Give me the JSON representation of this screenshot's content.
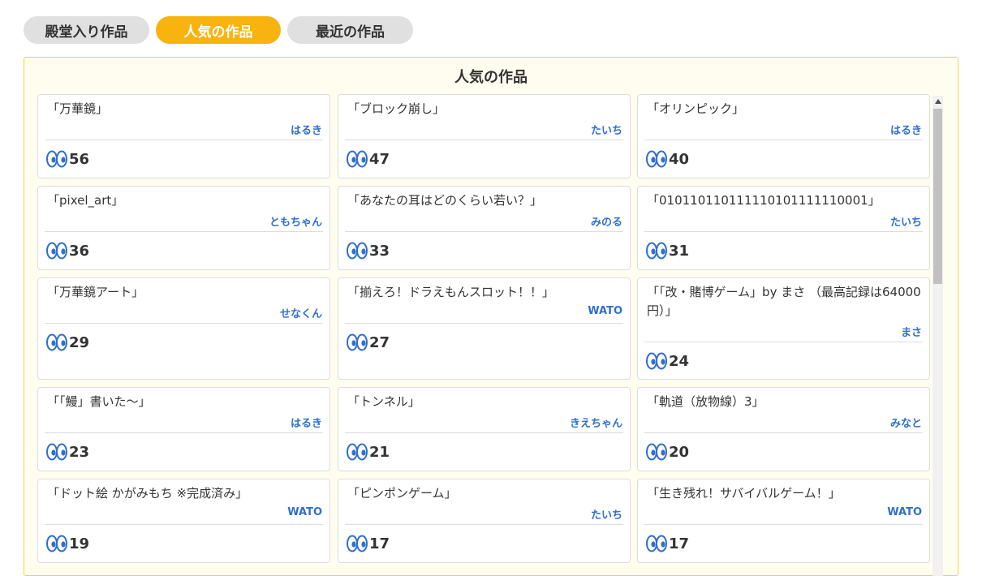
{
  "tabs": [
    {
      "label": "殿堂入り作品",
      "active": false
    },
    {
      "label": "人気の作品",
      "active": true
    },
    {
      "label": "最近の作品",
      "active": false
    }
  ],
  "panel": {
    "title": "人気の作品"
  },
  "icons": {
    "views": "eyes-icon",
    "scroll_up": "arrow-up-icon"
  },
  "colors": {
    "accent": "#f8b30f",
    "author": "#2f6fcf",
    "eyes": "#2f6fcf",
    "panel_border": "#f0d23c",
    "panel_bg": "#fffdf0"
  },
  "works": [
    {
      "title": "「万華鏡」",
      "author": "はるき",
      "views": "56"
    },
    {
      "title": "「ブロック崩し」",
      "author": "たいち",
      "views": "47"
    },
    {
      "title": "「オリンピック」",
      "author": "はるき",
      "views": "40"
    },
    {
      "title": "「pixel_art」",
      "author": "ともちゃん",
      "views": "36"
    },
    {
      "title": "「あなたの耳はどのくらい若い？」",
      "author": "みのる",
      "views": "33"
    },
    {
      "title": "「010110110111110101111110001」",
      "author": "たいち",
      "views": "31"
    },
    {
      "title": "「万華鏡アート」",
      "author": "せなくん",
      "views": "29"
    },
    {
      "title": "「揃えろ！ドラえもんスロット！！」",
      "author": "WATO",
      "views": "27"
    },
    {
      "title": "「「改・賭博ゲーム」by まさ （最高記録は64000円）」",
      "author": "まさ",
      "views": "24"
    },
    {
      "title": "「「鰻」書いた〜」",
      "author": "はるき",
      "views": "23"
    },
    {
      "title": "「トンネル」",
      "author": "きえちゃん",
      "views": "21"
    },
    {
      "title": "「軌道（放物線）3」",
      "author": "みなと",
      "views": "20"
    },
    {
      "title": "「ドット絵 かがみもち ※完成済み」",
      "author": "WATO",
      "views": "19"
    },
    {
      "title": "「ピンポンゲーム」",
      "author": "たいち",
      "views": "17"
    },
    {
      "title": "「生き残れ！サバイバルゲーム！」",
      "author": "WATO",
      "views": "17"
    }
  ]
}
